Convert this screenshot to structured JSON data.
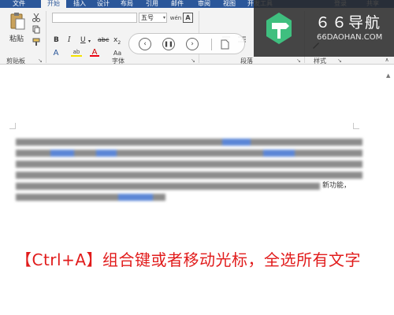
{
  "tabs": [
    {
      "label": "文件"
    },
    {
      "label": "开始"
    },
    {
      "label": "插入"
    },
    {
      "label": "设计"
    },
    {
      "label": "布局"
    },
    {
      "label": "引用"
    },
    {
      "label": "邮件"
    },
    {
      "label": "审阅"
    },
    {
      "label": "视图"
    },
    {
      "label": "开发工具"
    },
    {
      "label": "登录"
    },
    {
      "label": "共享"
    }
  ],
  "clipboard": {
    "paste_label": "粘贴",
    "group_label": "剪贴板"
  },
  "font": {
    "size_value": "五号",
    "group_label": "字体"
  },
  "paragraph": {
    "group_label": "段落"
  },
  "styles": {
    "group_label": "样式"
  },
  "watermark": {
    "title": "６６导航",
    "subtitle": "66DAOHAN.COM"
  },
  "document": {
    "visible_fragment": "新功能，"
  },
  "caption": "【Ctrl+A】组合键或者移动光标，全选所有文字",
  "colors": {
    "ribbon_blue": "#2b579a",
    "caption_red": "#e11b1b",
    "logo_green": "#3fbf7f"
  }
}
